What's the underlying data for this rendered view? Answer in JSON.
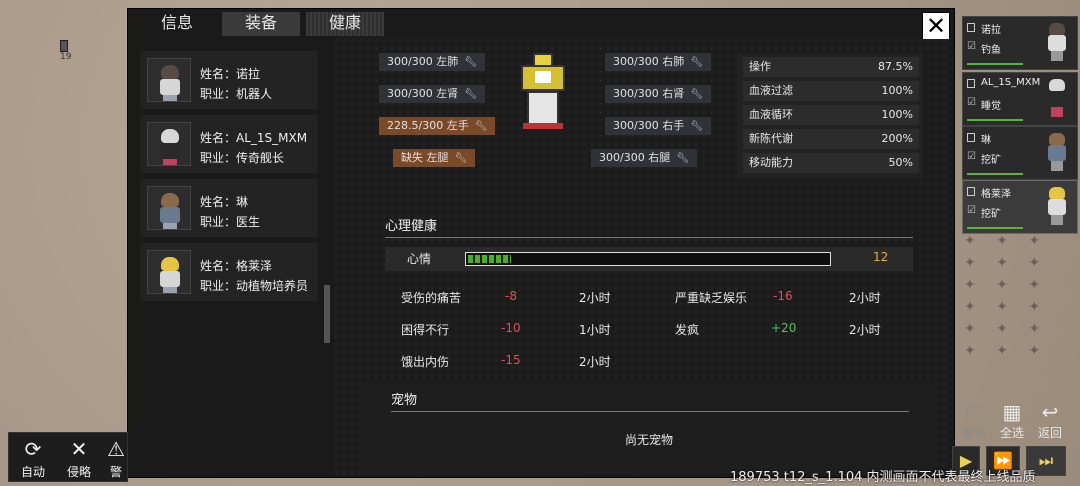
{
  "tabs": [
    {
      "label": "信息"
    },
    {
      "label": "装备"
    },
    {
      "label": "健康"
    }
  ],
  "close_label": "✕",
  "ground_badge": "19",
  "colonists": [
    {
      "name_line": "姓名：诺拉",
      "job_line": "职业：机器人",
      "hair": "#5a4a44"
    },
    {
      "name_line": "姓名：AL_1S_MXM",
      "job_line": "职业：传奇舰长",
      "hair": "#d8d8d8"
    },
    {
      "name_line": "姓名：琳",
      "job_line": "职业：医生",
      "hair": "#8a6a4a"
    },
    {
      "name_line": "姓名：格莱泽",
      "job_line": "职业：动植物培养员",
      "hair": "#e6c640"
    }
  ],
  "body_parts": {
    "left_lung": "300/300 左肺",
    "left_kidney": "300/300 左肾",
    "left_hand": "228.5/300 左手",
    "left_leg": "缺失 左腿",
    "right_lung": "300/300 右肺",
    "right_kidney": "300/300 右肾",
    "right_hand": "300/300 右手",
    "right_leg": "300/300 右腿"
  },
  "capacities": [
    {
      "label": "操作",
      "value": "87.5%"
    },
    {
      "label": "血液过滤",
      "value": "100%"
    },
    {
      "label": "血液循环",
      "value": "100%"
    },
    {
      "label": "新陈代谢",
      "value": "200%"
    },
    {
      "label": "移动能力",
      "value": "50%"
    }
  ],
  "mental": {
    "title": "心理健康",
    "mood_label": "心情",
    "mood_value": "12",
    "mood_fill": 0.12
  },
  "thoughts": [
    {
      "name": "受伤的痛苦",
      "value": "-8",
      "duration": "2小时"
    },
    {
      "name": "困得不行",
      "value": "-10",
      "duration": "1小时"
    },
    {
      "name": "饿出内伤",
      "value": "-15",
      "duration": "2小时"
    },
    {
      "name": "严重缺乏娱乐",
      "value": "-16",
      "duration": "2小时"
    },
    {
      "name": "发疯",
      "value": "+20",
      "duration": "2小时"
    }
  ],
  "pets": {
    "title": "宠物",
    "empty": "尚无宠物"
  },
  "right_cards": [
    {
      "name": "诺拉",
      "job": "钓鱼",
      "hair": "#5a4a44"
    },
    {
      "name": "AL_1S_MXM",
      "job": "睡觉",
      "hair": "#d8d8d8"
    },
    {
      "name": "琳",
      "job": "挖矿",
      "hair": "#8a6a4a"
    },
    {
      "name": "格莱泽",
      "job": "挖矿",
      "hair": "#e6c640"
    }
  ],
  "right_buttons": {
    "filter": "框选",
    "select_all": "全选",
    "back": "返回"
  },
  "bottom_buttons": {
    "auto": "自动",
    "invade": "侵略",
    "alert": "警"
  },
  "footer_note": "189753 t12_s_1.104  内测画面不代表最终上线品质"
}
